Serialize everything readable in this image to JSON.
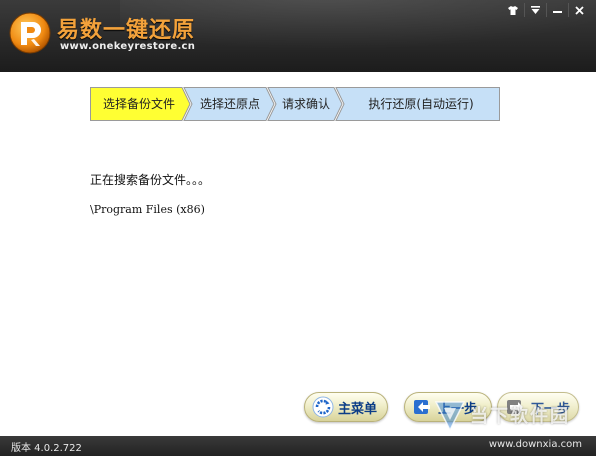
{
  "header": {
    "title": "易数一键还原",
    "url": "www.onekeyrestore.cn",
    "logo_icon": "restore-logo-icon",
    "window_controls": [
      "shirt-icon",
      "menu-dropdown-icon",
      "minimize-icon",
      "close-icon"
    ]
  },
  "steps": [
    {
      "label": "选择备份文件",
      "active": true
    },
    {
      "label": "选择还原点",
      "active": false
    },
    {
      "label": "请求确认",
      "active": false
    },
    {
      "label": "执行还原(自动运行)",
      "active": false
    }
  ],
  "main": {
    "status": "正在搜索备份文件。。。",
    "path": "\\Program Files (x86)"
  },
  "buttons": {
    "main_menu": "主菜单",
    "prev": "上一步",
    "next": "下一步"
  },
  "footer": {
    "version": "版本 4.0.2.722"
  },
  "watermark": {
    "text": "当下软件园",
    "url": "www.downxia.com"
  },
  "colors": {
    "active_step": "#ffff33",
    "inactive_step": "#c6e0f7",
    "title": "#f3a23b",
    "button_text": "#0c3d87"
  }
}
